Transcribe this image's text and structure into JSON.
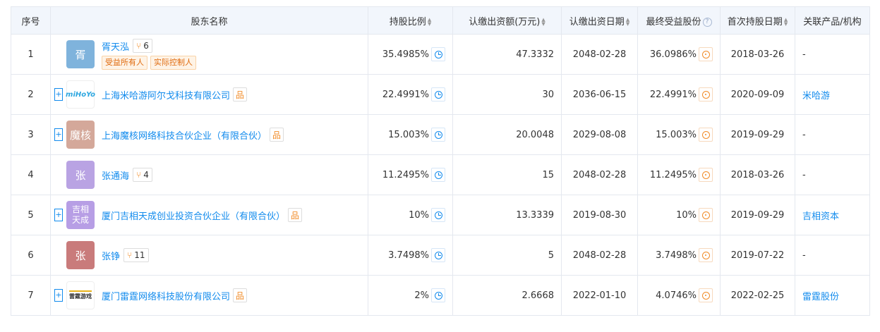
{
  "headers": {
    "idx": "序号",
    "name": "股东名称",
    "ratio": "持股比例",
    "amount": "认缴出资额(万元)",
    "date": "认缴出资日期",
    "final": "最终受益股份",
    "first": "首次持股日期",
    "related": "关联产品/机构"
  },
  "help_icon": "?",
  "rows": [
    {
      "idx": "1",
      "avatar": "胥",
      "name": "胥天泓",
      "badge": "6",
      "tags": [
        "受益所有人",
        "实际控制人"
      ],
      "ratio": "35.4985%",
      "amount": "47.3332",
      "date": "2048-02-28",
      "final": "36.0986%",
      "first": "2018-03-26",
      "related": "-"
    },
    {
      "idx": "2",
      "avatar": "miHoYo",
      "name": "上海米哈游阿尔戈科技有限公司",
      "ratio": "22.4991%",
      "amount": "30",
      "date": "2036-06-15",
      "final": "22.4991%",
      "first": "2020-09-09",
      "related": "米哈游"
    },
    {
      "idx": "3",
      "avatar": "魔核",
      "name": "上海魔核网络科技合伙企业（有限合伙）",
      "ratio": "15.003%",
      "amount": "20.0048",
      "date": "2029-08-08",
      "final": "15.003%",
      "first": "2019-09-29",
      "related": "-"
    },
    {
      "idx": "4",
      "avatar": "张",
      "name": "张通海",
      "badge": "4",
      "ratio": "11.2495%",
      "amount": "15",
      "date": "2048-02-28",
      "final": "11.2495%",
      "first": "2018-03-26",
      "related": "-"
    },
    {
      "idx": "5",
      "avatar": "吉相天成",
      "name": "厦门吉相天成创业投资合伙企业（有限合伙）",
      "ratio": "10%",
      "amount": "13.3339",
      "date": "2019-08-30",
      "final": "10%",
      "first": "2019-09-29",
      "related": "吉相资本"
    },
    {
      "idx": "6",
      "avatar": "张",
      "name": "张铮",
      "badge": "11",
      "ratio": "3.7498%",
      "amount": "5",
      "date": "2048-02-28",
      "final": "3.7498%",
      "first": "2019-07-22",
      "related": "-"
    },
    {
      "idx": "7",
      "avatar": "雷霆游戏",
      "name": "厦门雷霆网络科技股份有限公司",
      "ratio": "2%",
      "amount": "2.6668",
      "date": "2022-01-10",
      "final": "4.0746%",
      "first": "2022-02-25",
      "related": "雷霆股份"
    }
  ],
  "colors": {
    "link": "#128bed",
    "accent_orange": "#f18c28",
    "header_bg": "#f2f6fc",
    "avatar_xu": "#7fb3dc",
    "avatar_mohe": "#d4a89a",
    "avatar_zhang_purple": "#b9a3e3",
    "avatar_jixiang": "#b79ee5",
    "avatar_zhang_red": "#c97b7b"
  }
}
